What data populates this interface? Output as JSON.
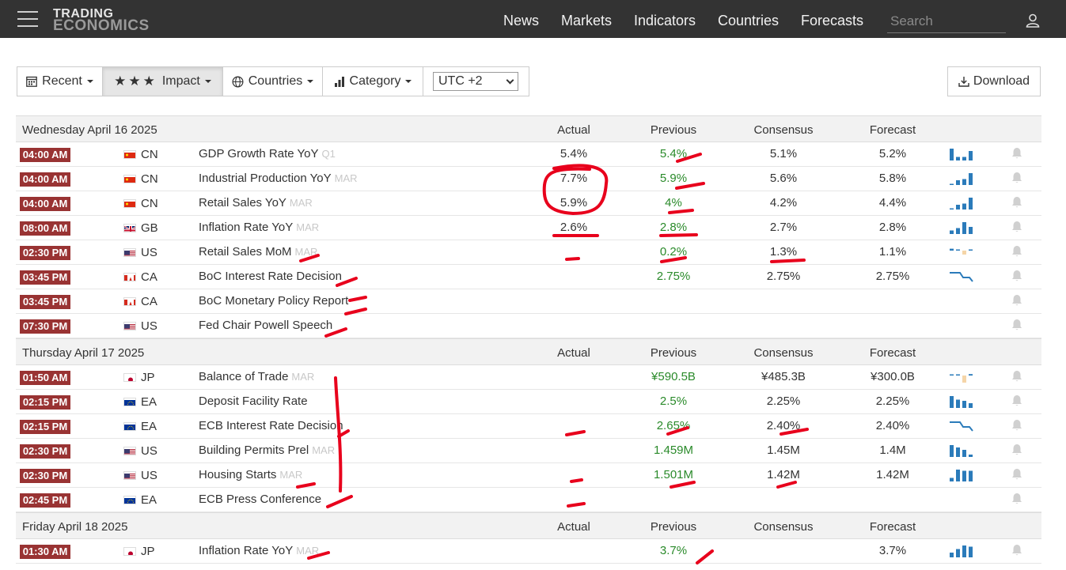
{
  "header": {
    "logo_line1": "TRADING",
    "logo_line2": "ECONOMICS",
    "nav": [
      "News",
      "Markets",
      "Indicators",
      "Countries",
      "Forecasts"
    ],
    "search_placeholder": "Search"
  },
  "filters": {
    "recent": "Recent",
    "impact": "Impact",
    "countries": "Countries",
    "category": "Category",
    "timezone": "UTC +2",
    "download": "Download"
  },
  "columns": {
    "actual": "Actual",
    "previous": "Previous",
    "consensus": "Consensus",
    "forecast": "Forecast"
  },
  "colors": {
    "time_badge": "#993333",
    "green_value": "#2a8a2a",
    "spark_blue": "#2b7bba",
    "spark_tan": "#f5d5a8",
    "annotation": "#e8001c"
  },
  "days": [
    {
      "date": "Wednesday April 16 2025",
      "events": [
        {
          "time": "04:00 AM",
          "flag": "cn",
          "country": "CN",
          "event": "GDP Growth Rate YoY",
          "ref": "Q1",
          "actual": "5.4%",
          "previous": "5.4%",
          "consensus": "5.1%",
          "forecast": "5.2%",
          "spark": [
            1,
            0.3,
            0.3,
            0.8
          ]
        },
        {
          "time": "04:00 AM",
          "flag": "cn",
          "country": "CN",
          "event": "Industrial Production YoY",
          "ref": "MAR",
          "actual": "7.7%",
          "previous": "5.9%",
          "consensus": "5.6%",
          "forecast": "5.8%",
          "spark": [
            0.1,
            0.4,
            0.5,
            1
          ]
        },
        {
          "time": "04:00 AM",
          "flag": "cn",
          "country": "CN",
          "event": "Retail Sales YoY",
          "ref": "MAR",
          "actual": "5.9%",
          "previous": "4%",
          "consensus": "4.2%",
          "forecast": "4.4%",
          "spark": [
            0.1,
            0.4,
            0.5,
            1
          ]
        },
        {
          "time": "08:00 AM",
          "flag": "gb",
          "country": "GB",
          "event": "Inflation Rate YoY",
          "ref": "MAR",
          "actual": "2.6%",
          "previous": "2.8%",
          "consensus": "2.7%",
          "forecast": "2.8%",
          "spark": [
            0.3,
            0.5,
            1,
            0.6
          ]
        },
        {
          "time": "02:30 PM",
          "flag": "us",
          "country": "US",
          "event": "Retail Sales MoM",
          "ref": "MAR",
          "actual": "",
          "previous": "0.2%",
          "consensus": "1.3%",
          "forecast": "1.1%",
          "spark": [
            0.4,
            0.2,
            -0.5,
            0.1
          ]
        },
        {
          "time": "03:45 PM",
          "flag": "ca",
          "country": "CA",
          "event": "BoC Interest Rate Decision",
          "ref": "",
          "actual": "",
          "previous": "2.75%",
          "consensus": "2.75%",
          "forecast": "2.75%",
          "spark_line": true
        },
        {
          "time": "03:45 PM",
          "flag": "ca",
          "country": "CA",
          "event": "BoC Monetary Policy Report",
          "ref": "",
          "actual": "",
          "previous": "",
          "consensus": "",
          "forecast": ""
        },
        {
          "time": "07:30 PM",
          "flag": "us",
          "country": "US",
          "event": "Fed Chair Powell Speech",
          "ref": "",
          "actual": "",
          "previous": "",
          "consensus": "",
          "forecast": ""
        }
      ]
    },
    {
      "date": "Thursday April 17 2025",
      "events": [
        {
          "time": "01:50 AM",
          "flag": "jp",
          "country": "JP",
          "event": "Balance of Trade",
          "ref": "MAR",
          "actual": "",
          "previous": "¥590.5B",
          "consensus": "¥485.3B",
          "forecast": "¥300.0B",
          "spark": [
            0.05,
            0.1,
            -0.9,
            0.3
          ]
        },
        {
          "time": "02:15 PM",
          "flag": "ea",
          "country": "EA",
          "event": "Deposit Facility Rate",
          "ref": "",
          "actual": "",
          "previous": "2.5%",
          "consensus": "2.25%",
          "forecast": "2.25%",
          "spark": [
            1,
            0.7,
            0.6,
            0.4
          ]
        },
        {
          "time": "02:15 PM",
          "flag": "ea",
          "country": "EA",
          "event": "ECB Interest Rate Decision",
          "ref": "",
          "actual": "",
          "previous": "2.65%",
          "consensus": "2.40%",
          "forecast": "2.40%",
          "spark_line": true
        },
        {
          "time": "02:30 PM",
          "flag": "us",
          "country": "US",
          "event": "Building Permits Prel",
          "ref": "MAR",
          "actual": "",
          "previous": "1.459M",
          "consensus": "1.45M",
          "forecast": "1.4M",
          "spark": [
            1,
            0.8,
            0.6,
            0.2
          ]
        },
        {
          "time": "02:30 PM",
          "flag": "us",
          "country": "US",
          "event": "Housing Starts",
          "ref": "MAR",
          "actual": "",
          "previous": "1.501M",
          "consensus": "1.42M",
          "forecast": "1.42M",
          "spark": [
            0.3,
            1,
            0.9,
            0.9
          ]
        },
        {
          "time": "02:45 PM",
          "flag": "ea",
          "country": "EA",
          "event": "ECB Press Conference",
          "ref": "",
          "actual": "",
          "previous": "",
          "consensus": "",
          "forecast": ""
        }
      ]
    },
    {
      "date": "Friday April 18 2025",
      "events": [
        {
          "time": "01:30 AM",
          "flag": "jp",
          "country": "JP",
          "event": "Inflation Rate YoY",
          "ref": "MAR",
          "actual": "",
          "previous": "3.7%",
          "consensus": "",
          "forecast": "3.7%",
          "spark": [
            0.4,
            0.7,
            1,
            0.9
          ]
        }
      ]
    }
  ]
}
